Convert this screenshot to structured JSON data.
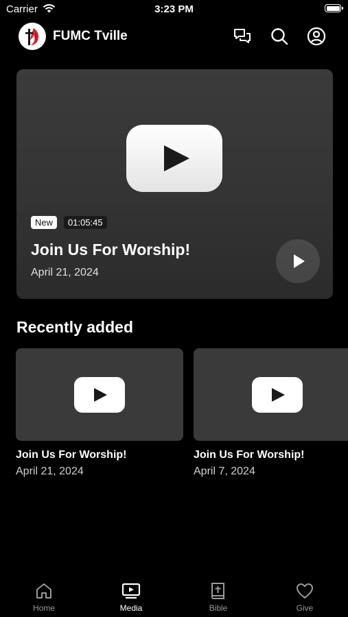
{
  "status_bar": {
    "carrier": "Carrier",
    "time": "3:23 PM"
  },
  "header": {
    "title": "FUMC Tville"
  },
  "hero": {
    "badge": "New",
    "duration": "01:05:45",
    "title": "Join Us For Worship!",
    "date": "April 21, 2024"
  },
  "recent": {
    "heading": "Recently added",
    "items": [
      {
        "title": "Join Us For Worship!",
        "date": "April 21, 2024"
      },
      {
        "title": "Join Us For Worship!",
        "date": "April 7, 2024"
      }
    ]
  },
  "tabs": [
    {
      "label": "Home",
      "icon": "home-icon",
      "active": false
    },
    {
      "label": "Media",
      "icon": "tv-play-icon",
      "active": true
    },
    {
      "label": "Bible",
      "icon": "bible-icon",
      "active": false
    },
    {
      "label": "Give",
      "icon": "heart-icon",
      "active": false
    }
  ],
  "colors": {
    "background": "#000000",
    "card": "#3a3a3a",
    "inactive_tab": "#9a9a9a",
    "logo_accent": "#d9232e"
  }
}
